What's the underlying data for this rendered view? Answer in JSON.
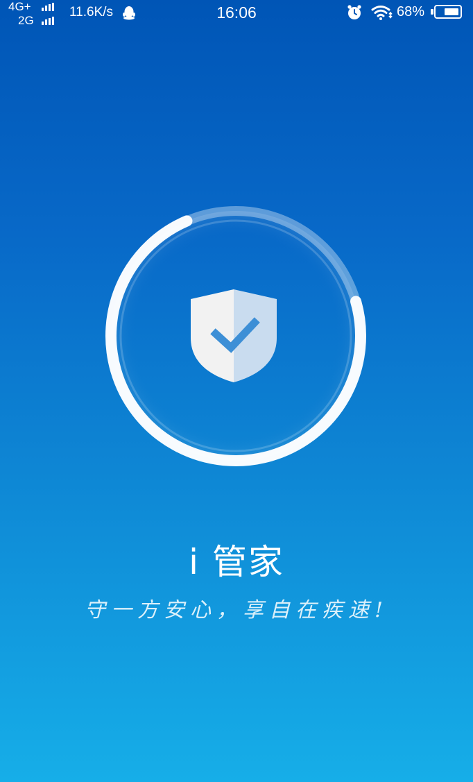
{
  "status_bar": {
    "network_primary": "4G+",
    "network_secondary": "2G",
    "net_speed": "11.6K/s",
    "time": "16:06",
    "battery_percent": "68%",
    "battery_level": 0.68,
    "icons": {
      "qq": "qq-penguin-icon",
      "alarm": "alarm-clock-icon",
      "wifi": "wifi-icon",
      "battery": "battery-icon"
    }
  },
  "splash": {
    "progress": 0.73,
    "emblem_icon": "shield-check-icon",
    "title": "i 管家",
    "slogan": "守一方安心，享自在疾速!"
  },
  "colors": {
    "background_top": "#0055b6",
    "background_bottom": "#16aee8",
    "ring": "#ffffff",
    "shield_left": "#f2f2f2",
    "shield_right": "#c9dcef",
    "checkmark": "#3d8fd6"
  }
}
